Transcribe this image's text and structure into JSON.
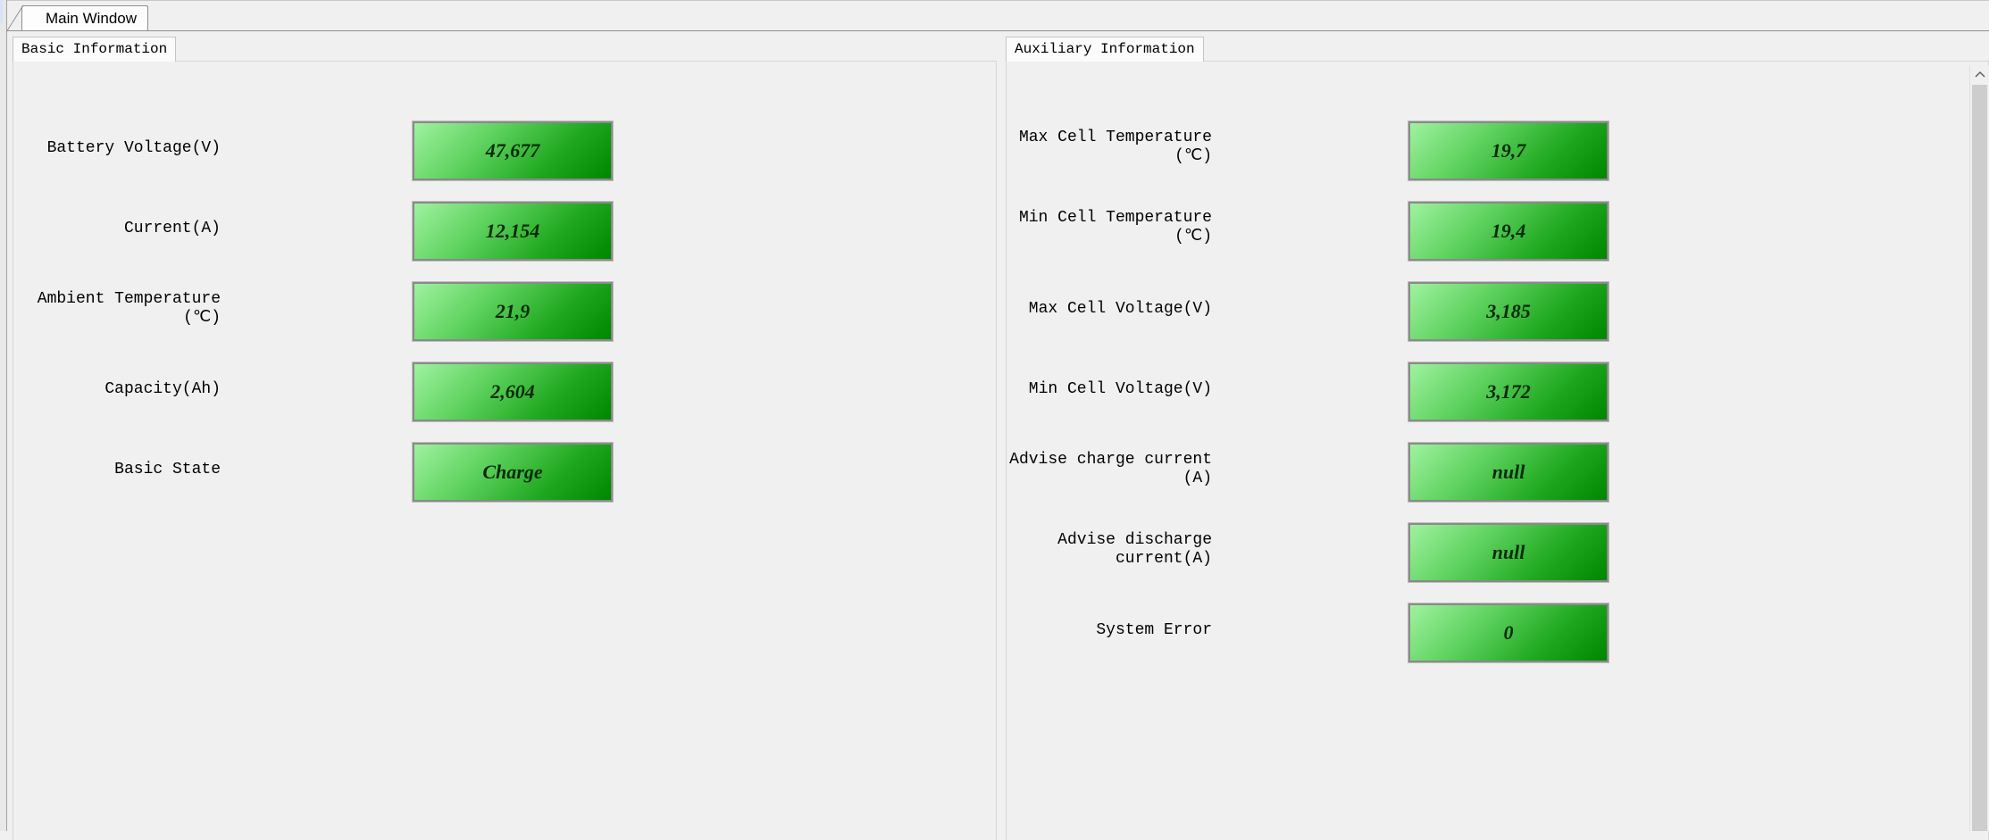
{
  "main_tab": {
    "label": "Main Window"
  },
  "basic": {
    "tab_label": "Basic Information",
    "rows": [
      {
        "label": "Battery Voltage(V)",
        "value": "47,677"
      },
      {
        "label": "Current(A)",
        "value": "12,154"
      },
      {
        "label": "Ambient Temperature\n(℃)",
        "value": "21,9"
      },
      {
        "label": "Capacity(Ah)",
        "value": "2,604"
      },
      {
        "label": "Basic State",
        "value": "Charge"
      }
    ]
  },
  "auxiliary": {
    "tab_label": "Auxiliary Information",
    "rows": [
      {
        "label": "Max Cell Temperature\n(℃)",
        "value": "19,7"
      },
      {
        "label": "Min Cell Temperature\n(℃)",
        "value": "19,4"
      },
      {
        "label": "Max Cell Voltage(V)",
        "value": "3,185"
      },
      {
        "label": "Min Cell Voltage(V)",
        "value": "3,172"
      },
      {
        "label": "Advise charge current\n(A)",
        "value": "null"
      },
      {
        "label": "Advise discharge\ncurrent(A)",
        "value": "null"
      },
      {
        "label": "System Error",
        "value": "0"
      }
    ]
  },
  "colors": {
    "value_gradient_light": "#9ff29f",
    "value_gradient_dark": "#008600",
    "background": "#f0f0f0"
  },
  "icons": {
    "scroll_up": "chevron-up-icon"
  }
}
